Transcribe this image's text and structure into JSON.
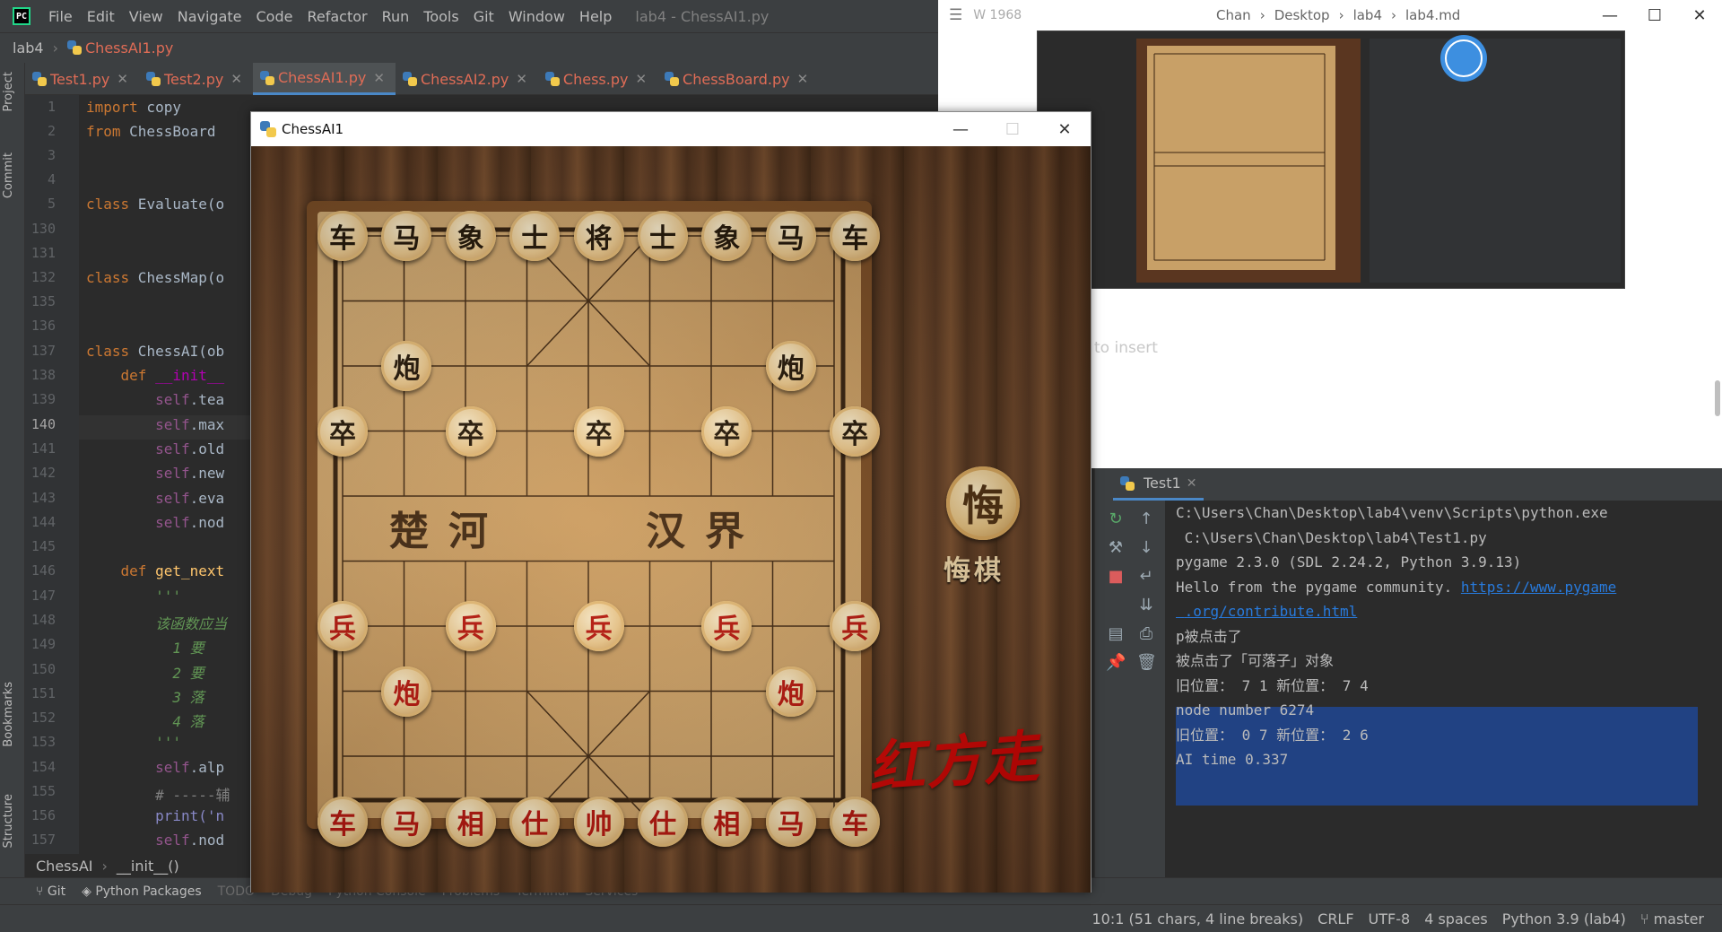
{
  "ide": {
    "menu": [
      "File",
      "Edit",
      "View",
      "Navigate",
      "Code",
      "Refactor",
      "Run",
      "Tools",
      "Git",
      "Window",
      "Help"
    ],
    "window_title": "lab4 - ChessAI1.py",
    "breadcrumb": {
      "project": "lab4",
      "file": "ChessAI1.py"
    },
    "tabs": [
      {
        "label": "Test1.py"
      },
      {
        "label": "Test2.py"
      },
      {
        "label": "ChessAI1.py"
      },
      {
        "label": "ChessAI2.py"
      },
      {
        "label": "Chess.py"
      },
      {
        "label": "ChessBoard.py"
      }
    ],
    "active_tab": "ChessAI1.py",
    "left_tools": [
      "Project",
      "Commit",
      "Bookmarks",
      "Structure"
    ],
    "line_numbers": [
      "1",
      "2",
      "3",
      "4",
      "5",
      "130",
      "131",
      "132",
      "135",
      "136",
      "137",
      "138",
      "139",
      "140",
      "141",
      "142",
      "143",
      "144",
      "145",
      "146",
      "147",
      "148",
      "149",
      "150",
      "151",
      "152",
      "153",
      "154",
      "155",
      "156",
      "157"
    ],
    "current_line": "140",
    "code": {
      "l1_kw": "import",
      "l1_rest": " copy",
      "l2_kw": "from",
      "l2_rest": " ChessBoard",
      "l5_kw": "class",
      "l5_rest": " Evaluate(o",
      "l132_kw": "class",
      "l132_rest": " ChessMap(o",
      "l137_kw": "class",
      "l137_rest": " ChessAI(ob",
      "l138_kw": "def",
      "l138_rest": " __init__",
      "self_kw": "self",
      "l139_rest": ".tea",
      "l140_rest": ".max",
      "l141_rest": ".old",
      "l142_rest": ".new",
      "l143_rest": ".eva",
      "l144_rest": ".nod",
      "l146_kw": "def",
      "l146_rest": " get_next",
      "doc_quote": "'''",
      "doc_line1": "该函数应当",
      "doc_line2": "1 要",
      "doc_line3": "2 要",
      "doc_line4": "3 落",
      "doc_line5": "4 落",
      "l154_rest": ".alp",
      "l155": "# -----辅",
      "l156": "print('n",
      "l157_rest": ".nod"
    },
    "code_crumbs": [
      "ChessAI",
      "__init__()"
    ],
    "toolwindows": [
      "Git",
      "Python Packages",
      "TODO",
      "Debug",
      "Python Console",
      "Problems",
      "Terminal",
      "Services"
    ],
    "status": {
      "position": "10:1 (51 chars, 4 line breaks)",
      "line_sep": "CRLF",
      "encoding": "UTF-8",
      "indent": "4 spaces",
      "interpreter": "Python 3.9 (lab4)",
      "branch": "master"
    }
  },
  "run": {
    "tab_label": "Test1",
    "lines": [
      "C:\\Users\\Chan\\Desktop\\lab4\\venv\\Scripts\\python.exe",
      " C:\\Users\\Chan\\Desktop\\lab4\\Test1.py",
      "pygame 2.3.0 (SDL 2.24.2, Python 3.9.13)",
      "Hello from the pygame community. ",
      "p被点击了",
      "被点击了「可落子」对象",
      "旧位置： 7 1 新位置： 7 4",
      "node number 6274",
      "旧位置： 0 7 新位置： 2 6",
      "AI time 0.337"
    ],
    "link_part1": "https://www.pygame",
    "link_part2": ".org/contribute.html"
  },
  "doc": {
    "wordcount": "W 1968",
    "path": [
      "Chan",
      "Desktop",
      "lab4",
      "lab4.md"
    ],
    "insert_hint": "to insert"
  },
  "game": {
    "title": "ChessAI1",
    "river_left": "楚河",
    "river_right": "汉界",
    "black_back_row": [
      "车",
      "马",
      "象",
      "士",
      "将",
      "士",
      "象",
      "马",
      "车"
    ],
    "black_cannon": "炮",
    "black_pawn": "卒",
    "red_back_row": [
      "车",
      "马",
      "相",
      "仕",
      "帅",
      "仕",
      "相",
      "马",
      "车"
    ],
    "red_cannon": "炮",
    "red_pawn": "兵",
    "undo_icon": "悔",
    "undo_label": "悔棋",
    "turn_text": "红方走",
    "colors": {
      "black_piece_text": "#1c1206",
      "red_piece_text": "#b8120c",
      "turn_text": "#d40000"
    }
  }
}
